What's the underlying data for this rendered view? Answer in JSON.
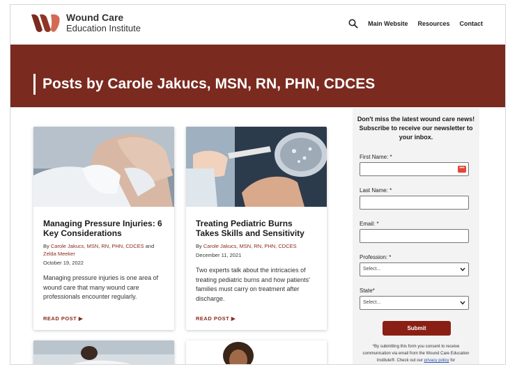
{
  "site": {
    "logo_line1": "Wound Care",
    "logo_line2": "Education Institute",
    "brand_color": "#7a2a1f"
  },
  "nav": {
    "search_icon": "search-icon",
    "items": [
      "Main Website",
      "Resources",
      "Contact"
    ]
  },
  "banner": {
    "title": "Posts by Carole Jakucs, MSN, RN, PHN, CDCES"
  },
  "posts": [
    {
      "title": "Managing Pressure Injuries: 6 Key Considerations",
      "by": "By",
      "author": "Carole Jakucs, MSN, RN, PHN, CDCES",
      "and": "and",
      "coauthor": "Zelda Meeker",
      "date": "October 19, 2022",
      "excerpt": "Managing pressure injuries is one area of wound care that many wound care professionals encounter regularly.",
      "read_more": "READ POST ▶"
    },
    {
      "title": "Treating Pediatric Burns Takes Skills and Sensitivity",
      "by": "By",
      "author": "Carole Jakucs, MSN, RN, PHN, CDCES",
      "date": "December 11, 2021",
      "excerpt": "Two experts talk about the intricacies of treating pediatric burns and how patients' families must carry on treatment after discharge.",
      "read_more": "READ POST ▶"
    }
  ],
  "newsletter": {
    "intro": "Don't miss the latest wound care news! Subscribe to receive our newsletter to your inbox.",
    "first_name_label": "First Name: *",
    "last_name_label": "Last Name: *",
    "email_label": "Email: *",
    "profession_label": "Profession: *",
    "profession_value": "Select...",
    "state_label": "State*",
    "state_value": "Select...",
    "submit_label": "Submit",
    "disclaimer_pre": "*By submitting this form you consent to receive communication via email from the Wound Care Education Institute®. Check out our",
    "privacy_link": "privacy policy",
    "disclaimer_post": "for"
  }
}
